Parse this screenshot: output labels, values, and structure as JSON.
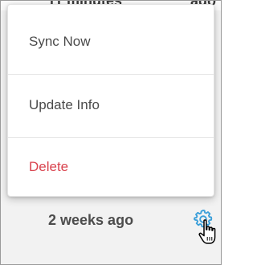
{
  "menu": {
    "items": [
      {
        "label": "Sync Now"
      },
      {
        "label": "Update Info"
      },
      {
        "label": "Delete"
      }
    ]
  },
  "row": {
    "time_label": "2 weeks ago"
  },
  "icons": {
    "settings": "gear-icon",
    "pointer": "mouse-pointer-icon"
  },
  "colors": {
    "delete_text": "#d9434e",
    "gear_accent": "#3b9fd9",
    "menu_text": "#4a4a4a"
  }
}
